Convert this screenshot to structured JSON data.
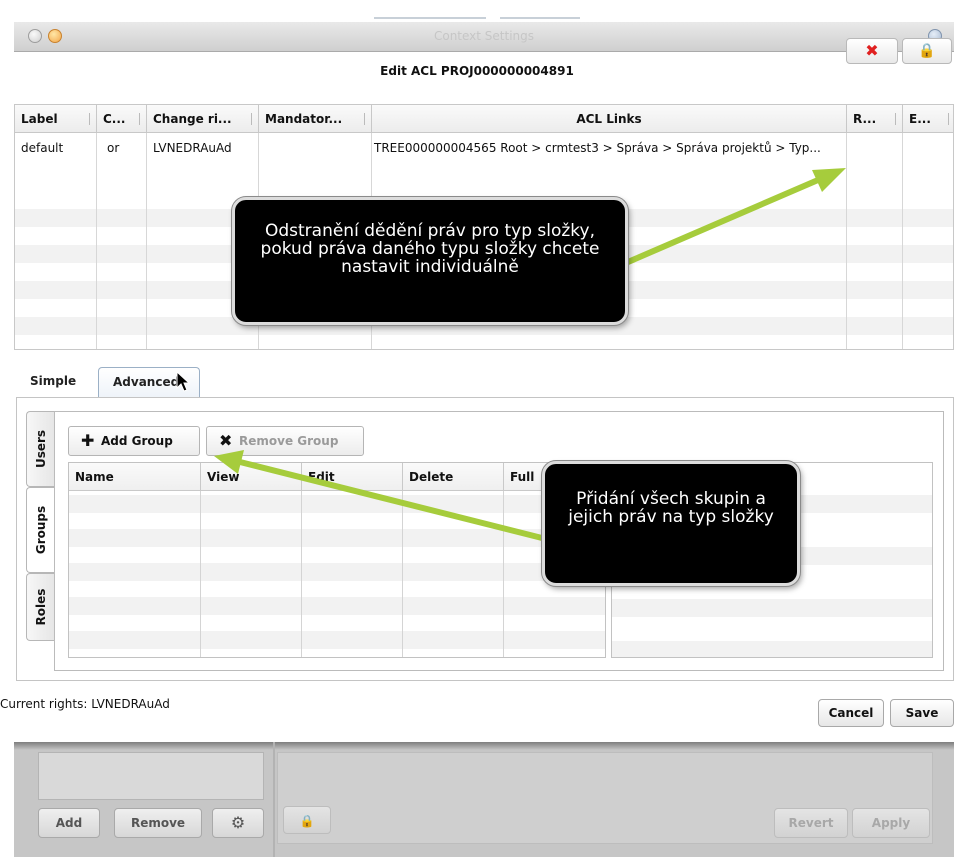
{
  "window": {
    "title": "Context Settings"
  },
  "dialog": {
    "title": "Edit ACL PROJ000000004891"
  },
  "acl_table": {
    "headers": [
      "Label",
      "C...",
      "Change ri...",
      "Mandator...",
      "ACL Links",
      "R...",
      "E..."
    ],
    "row": {
      "label": "default",
      "c": "or",
      "change_rights": "LVNEDRAuAd",
      "mandatory": "",
      "acl_links": "TREE000000004565 Root > crmtest3 > Správa > Správa projektů > Typ..."
    }
  },
  "tabs": {
    "simple": "Simple",
    "advanced": "Advanced"
  },
  "side_tabs": [
    "Users",
    "Groups",
    "Roles"
  ],
  "toolbar": {
    "add_group": "Add Group",
    "remove_group": "Remove Group"
  },
  "groups_table": {
    "headers": [
      "Name",
      "View",
      "Edit",
      "Delete",
      "Full"
    ]
  },
  "footer": {
    "current_rights_label": "Current rights:",
    "current_rights_value": "LVNEDRAuAd",
    "cancel": "Cancel",
    "save": "Save"
  },
  "under_window": {
    "add": "Add",
    "remove": "Remove",
    "revert": "Revert",
    "apply": "Apply"
  },
  "callouts": {
    "remove_inheritance": "Odstranění dědění práv pro typ složky, pokud práva daného typu složky chcete nastavit individuálně",
    "add_all_groups": "Přidání všech skupin a jejich práv na typ složky"
  },
  "colors": {
    "callout_arrow": "#a6cc3c",
    "remove_icon": "#e02020",
    "lock_icon": "#e0a020"
  }
}
